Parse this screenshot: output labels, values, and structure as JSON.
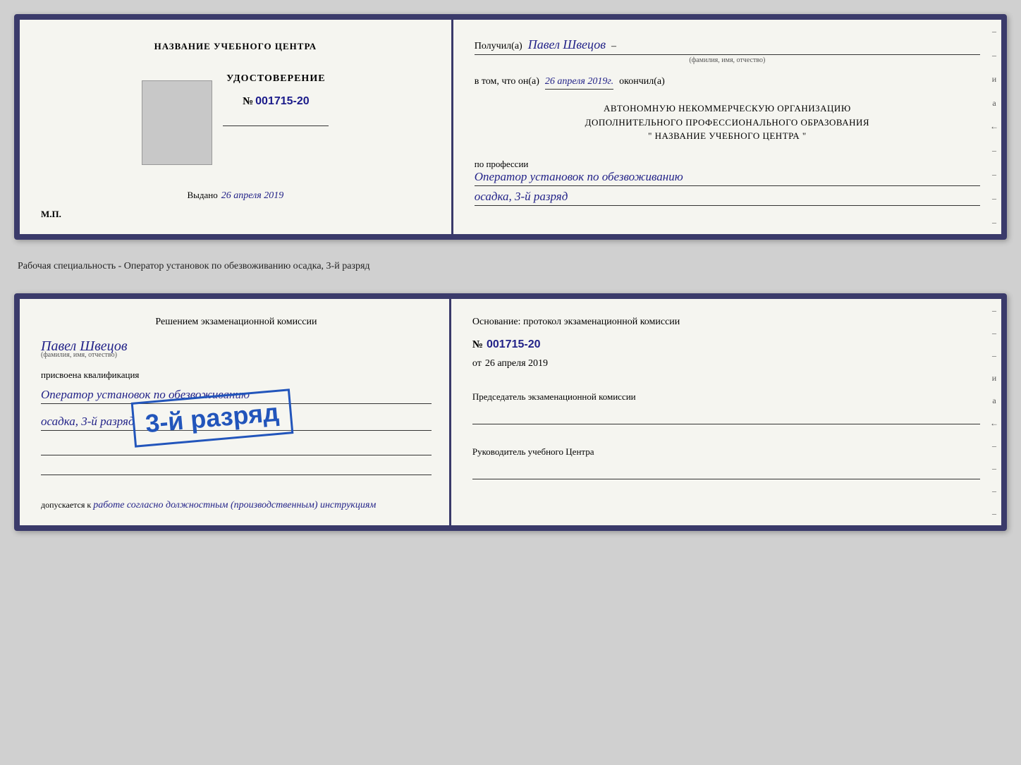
{
  "top_cert": {
    "left": {
      "title": "НАЗВАНИЕ УЧЕБНОГО ЦЕНТРА",
      "doc_type": "УДОСТОВЕРЕНИЕ",
      "number_prefix": "№",
      "number": "001715-20",
      "issued_label": "Выдано",
      "issued_date": "26 апреля 2019",
      "mp": "М.П."
    },
    "right": {
      "received_label": "Получил(а)",
      "name_handwritten": "Павел Швецов",
      "name_subtitle": "(фамилия, имя, отчество)",
      "dash": "–",
      "in_that": "в том, что он(а)",
      "date_handwritten": "26 апреля 2019г.",
      "finished_label": "окончил(а)",
      "org_line1": "АВТОНОМНУЮ НЕКОММЕРЧЕСКУЮ ОРГАНИЗАЦИЮ",
      "org_line2": "ДОПОЛНИТЕЛЬНОГО ПРОФЕССИОНАЛЬНОГО ОБРАЗОВАНИЯ",
      "org_line3": "\"  НАЗВАНИЕ УЧЕБНОГО ЦЕНТРА  \"",
      "profession_label": "по профессии",
      "profession_text": "Оператор установок по обезвоживанию",
      "profession_sub": "осадка, 3-й разряд",
      "right_marks": [
        "–",
        "–",
        "и",
        "а",
        "←",
        "–",
        "–",
        "–",
        "–"
      ]
    }
  },
  "separator": {
    "text": "Рабочая специальность - Оператор установок по обезвоживанию осадка, 3-й разряд"
  },
  "bottom_cert": {
    "left": {
      "decision_label": "Решением экзаменационной комиссии",
      "name_handwritten": "Павел Швецов",
      "name_subtitle": "(фамилия, имя, отчество)",
      "assigned_label": "присвоена квалификация",
      "qualification_text": "Оператор установок по обезвоживанию",
      "qualification_sub": "осадка, 3-й разряд",
      "allowed_label": "допускается к",
      "allowed_text": "работе согласно должностным (производственным) инструкциям"
    },
    "stamp": {
      "text": "3-й разряд"
    },
    "right": {
      "basis_label": "Основание: протокол экзаменационной комиссии",
      "number_prefix": "№",
      "protocol_number": "001715-20",
      "date_prefix": "от",
      "date": "26 апреля 2019",
      "chairman_label": "Председатель экзаменационной комиссии",
      "director_label": "Руководитель учебного Центра",
      "right_marks": [
        "–",
        "–",
        "–",
        "и",
        "а",
        "←",
        "–",
        "–",
        "–",
        "–"
      ]
    }
  }
}
